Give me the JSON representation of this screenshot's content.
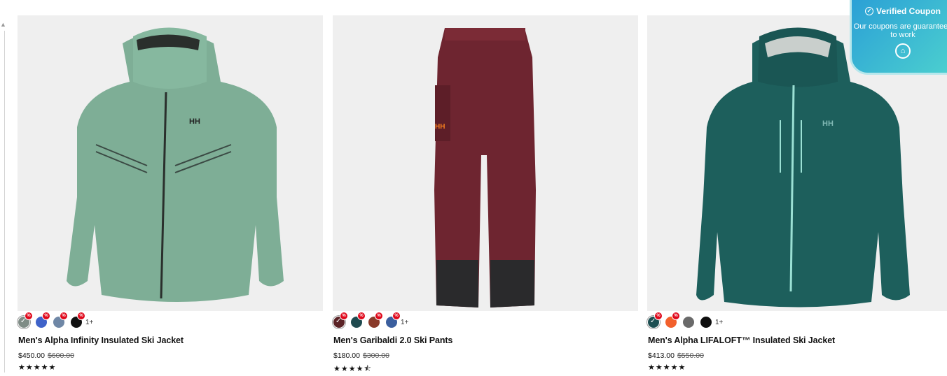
{
  "products": [
    {
      "name": "Men's Alpha Infinity Insulated Ski Jacket",
      "price": "$450.00",
      "old_price": "$600.00",
      "rating": 5,
      "more_colors": "1+",
      "swatches": [
        {
          "color": "#7f8c86",
          "sale": true,
          "selected": true
        },
        {
          "color": "#3f63c9",
          "sale": true,
          "selected": false
        },
        {
          "color": "#6f87a6",
          "sale": true,
          "selected": false
        },
        {
          "color": "#111111",
          "sale": true,
          "selected": false
        }
      ]
    },
    {
      "name": "Men's Garibaldi 2.0 Ski Pants",
      "price": "$180.00",
      "old_price": "$300.00",
      "rating": 4.5,
      "more_colors": "1+",
      "swatches": [
        {
          "color": "#5b2326",
          "sale": true,
          "selected": true
        },
        {
          "color": "#1f4a4f",
          "sale": true,
          "selected": false
        },
        {
          "color": "#8a3a2a",
          "sale": true,
          "selected": false
        },
        {
          "color": "#3b5f9e",
          "sale": true,
          "selected": false
        }
      ]
    },
    {
      "name": "Men's Alpha LIFALOFT™ Insulated Ski Jacket",
      "price": "$413.00",
      "old_price": "$550.00",
      "rating": 5,
      "more_colors": "1+",
      "swatches": [
        {
          "color": "#1d4f52",
          "sale": true,
          "selected": true
        },
        {
          "color": "#f2602c",
          "sale": true,
          "selected": false
        },
        {
          "color": "#6a6a6a",
          "sale": false,
          "selected": false
        },
        {
          "color": "#0f0f0f",
          "sale": false,
          "selected": false
        }
      ]
    }
  ],
  "coupon": {
    "title": "Verified Coupon",
    "body": "Our coupons are guaranteed to work",
    "icon": "home-icon"
  },
  "icons": {
    "sale_badge": "%",
    "check": "✓",
    "star_full": "★",
    "star_half": "⯪"
  }
}
